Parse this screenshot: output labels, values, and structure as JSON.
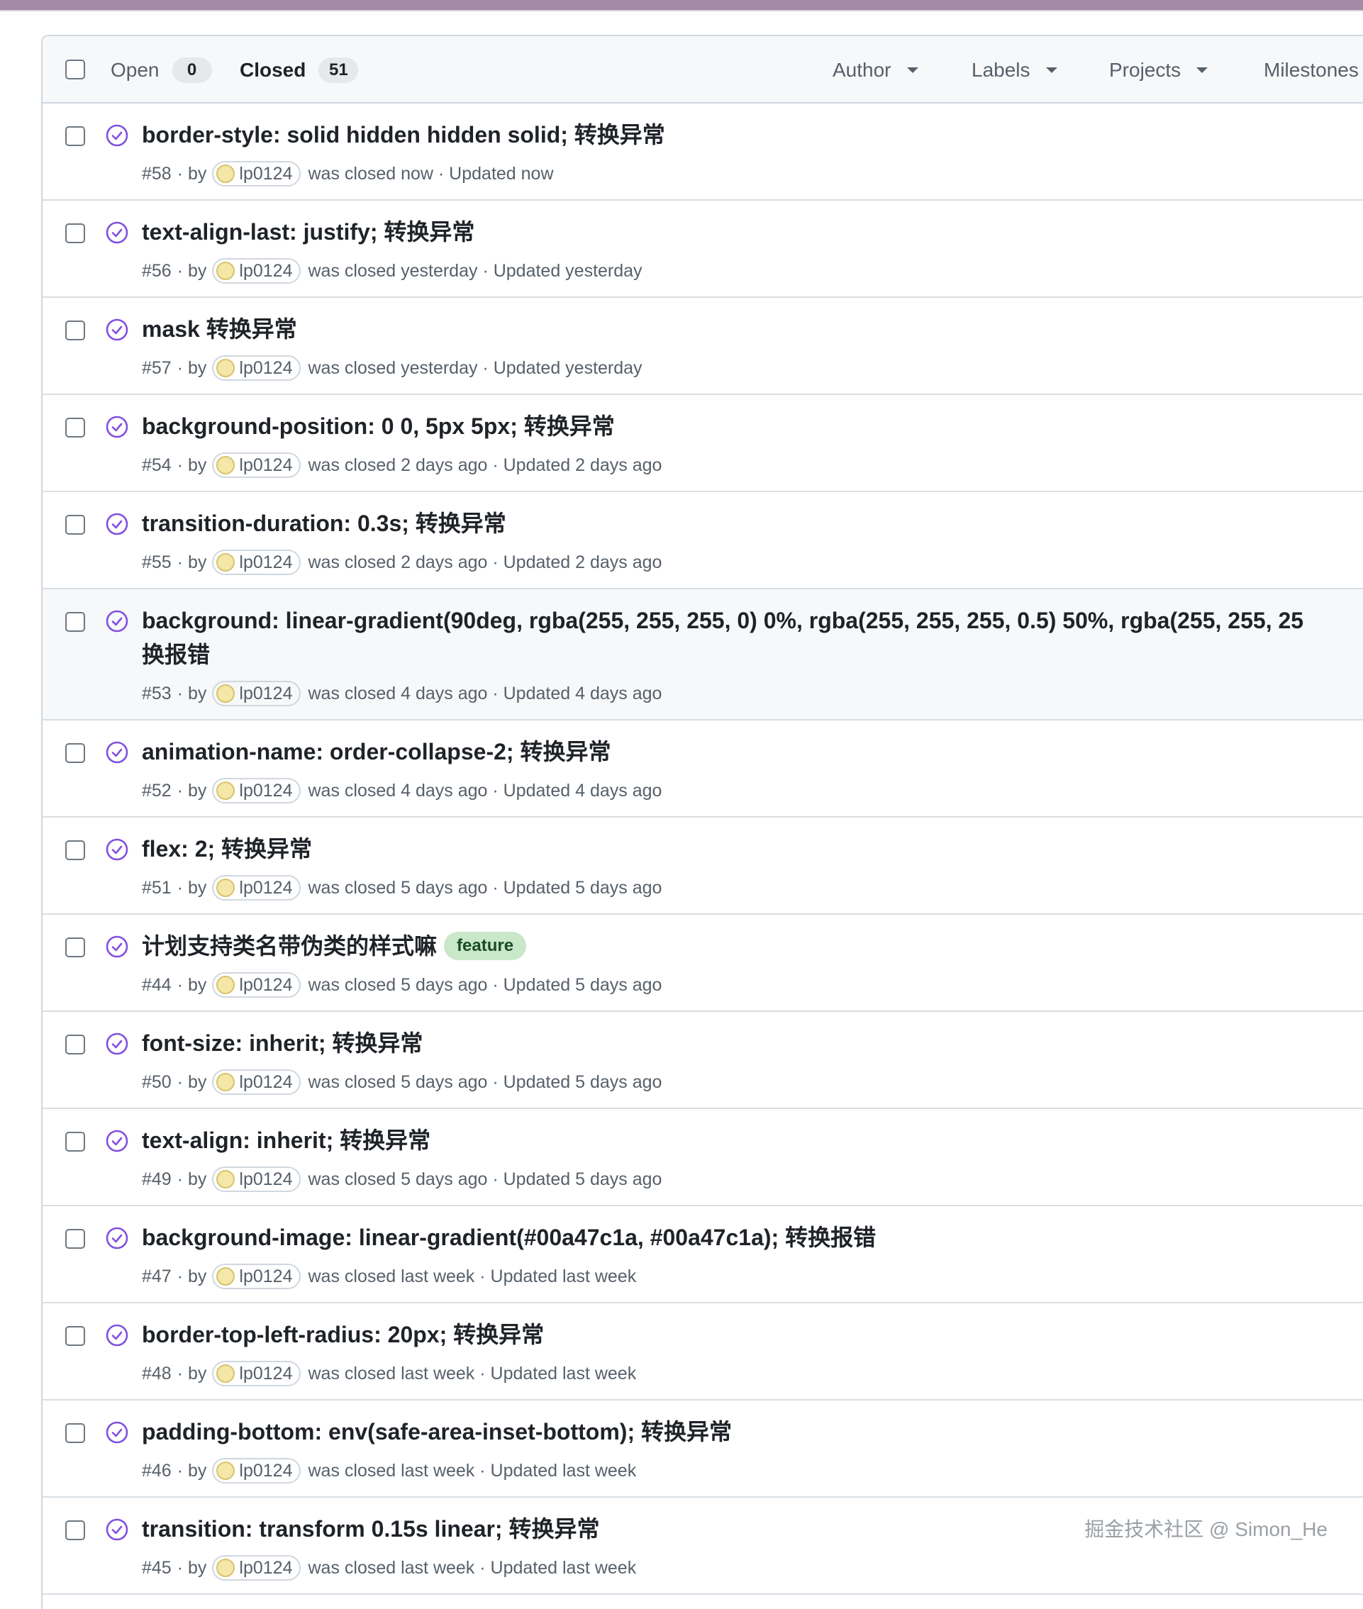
{
  "header": {
    "open_label": "Open",
    "open_count": "0",
    "closed_label": "Closed",
    "closed_count": "51",
    "filters": [
      "Author",
      "Labels",
      "Projects",
      "Milestones"
    ]
  },
  "issues": [
    {
      "title": "border-style: solid hidden hidden solid; 转换异常",
      "number": "#58",
      "by": "· by",
      "author": "lp0124",
      "closed": "was closed now · Updated now"
    },
    {
      "title": "text-align-last: justify; 转换异常",
      "number": "#56",
      "by": "· by",
      "author": "lp0124",
      "closed": "was closed yesterday · Updated yesterday"
    },
    {
      "title": "mask 转换异常",
      "number": "#57",
      "by": "· by",
      "author": "lp0124",
      "closed": "was closed yesterday · Updated yesterday"
    },
    {
      "title": "background-position: 0 0, 5px 5px; 转换异常",
      "number": "#54",
      "by": "· by",
      "author": "lp0124",
      "closed": "was closed 2 days ago · Updated 2 days ago"
    },
    {
      "title": "transition-duration: 0.3s; 转换异常",
      "number": "#55",
      "by": "· by",
      "author": "lp0124",
      "closed": "was closed 2 days ago · Updated 2 days ago"
    },
    {
      "title": "background: linear-gradient(90deg, rgba(255, 255, 255, 0) 0%, rgba(255, 255, 255, 0.5) 50%, rgba(255, 255, 25",
      "title_line2": "换报错",
      "number": "#53",
      "by": "· by",
      "author": "lp0124",
      "closed": "was closed 4 days ago · Updated 4 days ago"
    },
    {
      "title": "animation-name: order-collapse-2; 转换异常",
      "number": "#52",
      "by": "· by",
      "author": "lp0124",
      "closed": "was closed 4 days ago · Updated 4 days ago"
    },
    {
      "title": "flex: 2; 转换异常",
      "number": "#51",
      "by": "· by",
      "author": "lp0124",
      "closed": "was closed 5 days ago · Updated 5 days ago"
    },
    {
      "title": "计划支持类名带伪类的样式嘛",
      "label": "feature",
      "number": "#44",
      "by": "· by",
      "author": "lp0124",
      "closed": "was closed 5 days ago · Updated 5 days ago"
    },
    {
      "title": "font-size: inherit; 转换异常",
      "number": "#50",
      "by": "· by",
      "author": "lp0124",
      "closed": "was closed 5 days ago · Updated 5 days ago"
    },
    {
      "title": "text-align: inherit; 转换异常",
      "number": "#49",
      "by": "· by",
      "author": "lp0124",
      "closed": "was closed 5 days ago · Updated 5 days ago"
    },
    {
      "title": "background-image: linear-gradient(#00a47c1a, #00a47c1a); 转换报错",
      "number": "#47",
      "by": "· by",
      "author": "lp0124",
      "closed": "was closed last week · Updated last week"
    },
    {
      "title": "border-top-left-radius: 20px; 转换异常",
      "number": "#48",
      "by": "· by",
      "author": "lp0124",
      "closed": "was closed last week · Updated last week"
    },
    {
      "title": "padding-bottom: env(safe-area-inset-bottom); 转换异常",
      "number": "#46",
      "by": "· by",
      "author": "lp0124",
      "closed": "was closed last week · Updated last week"
    },
    {
      "title": "transition: transform 0.15s linear; 转换异常",
      "number": "#45",
      "by": "· by",
      "author": "lp0124",
      "closed": "was closed last week · Updated last week"
    }
  ],
  "watermark": "掘金技术社区 @ Simon_He",
  "colors": {
    "closed_icon": "#8250df",
    "label_feature_bg": "#c9e7c9",
    "border": "#d0d7de",
    "muted_text": "#57606a"
  },
  "icons": {
    "issue_state": "issue-closed-completed-icon",
    "filter_caret": "triangle-down-icon"
  }
}
